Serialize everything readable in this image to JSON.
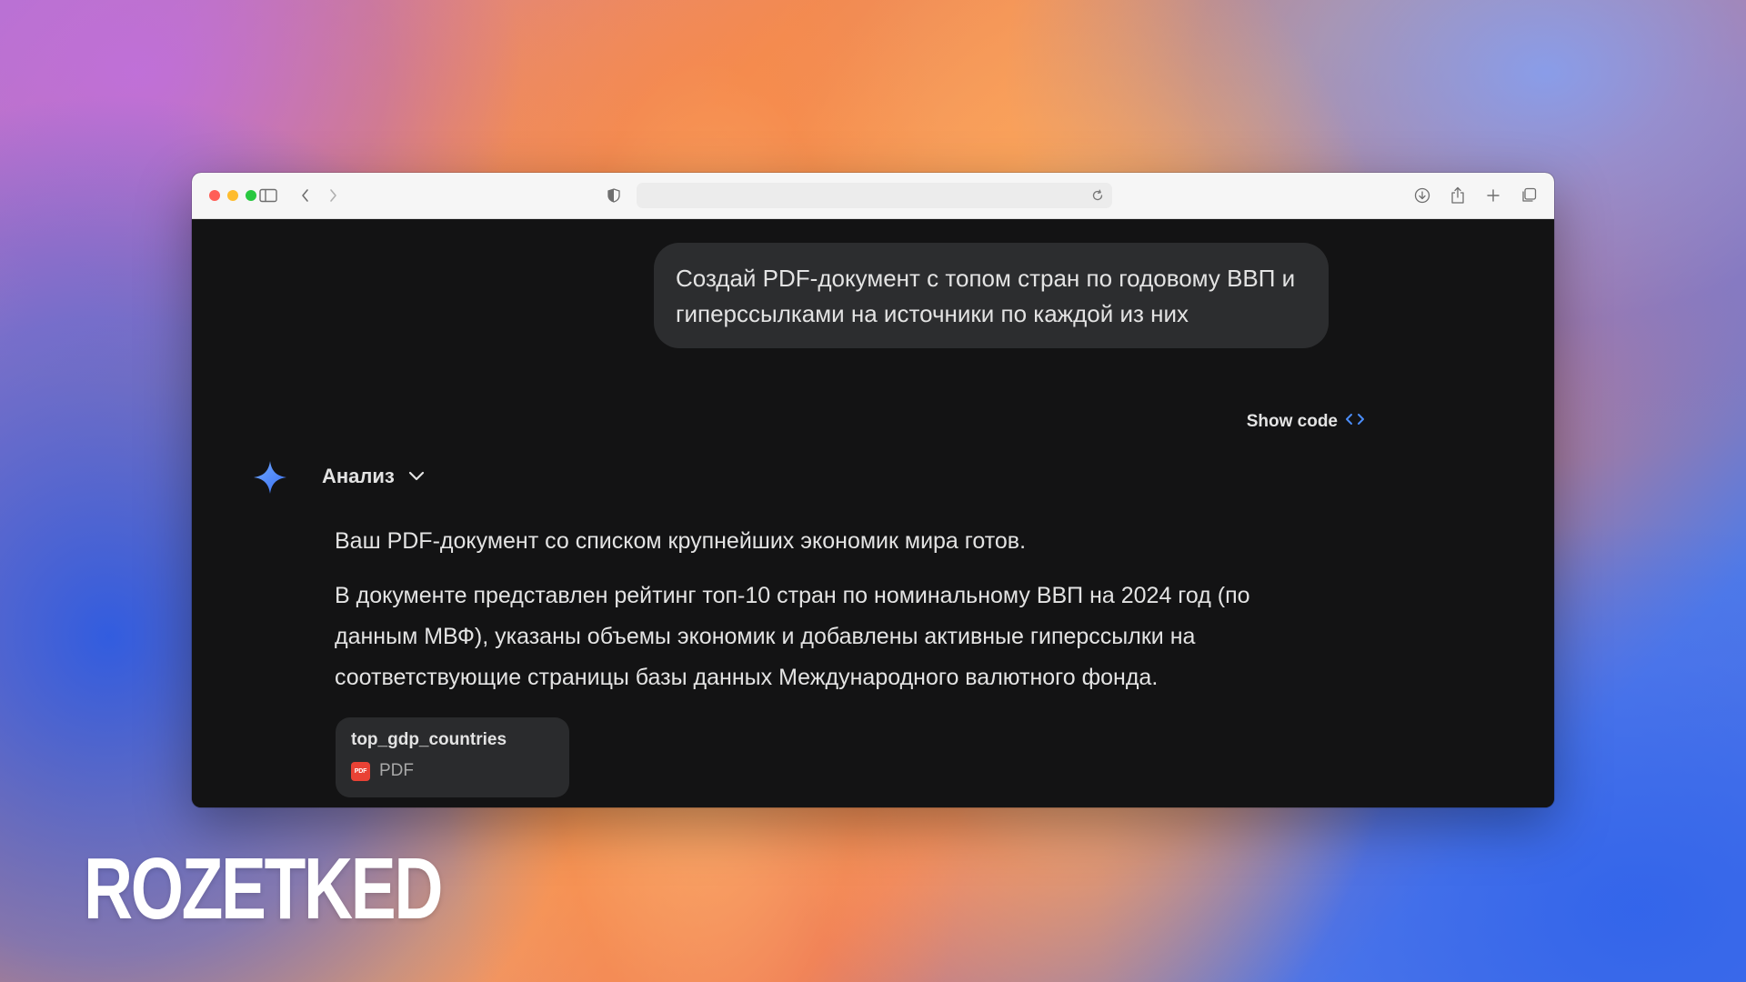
{
  "browser": {
    "address_text": "",
    "icons": {
      "sidebar": "sidebar-icon",
      "back": "chevron-left-icon",
      "forward": "chevron-right-icon",
      "privacy": "shield-icon",
      "reload": "reload-icon",
      "download": "download-icon",
      "share": "share-icon",
      "new_tab": "plus-icon",
      "tabs": "tab-overview-icon"
    }
  },
  "chat": {
    "user_message": "Создай PDF-документ с топом стран по годовому ВВП и гиперссылками на источники по каждой из них",
    "show_code_label": "Show code",
    "analysis_label": "Анализ",
    "response": {
      "paragraph1": "Ваш PDF-документ со списком крупнейших экономик мира готов.",
      "paragraph2": "В документе представлен рейтинг топ-10 стран по номинальному ВВП на 2024 год (по данным МВФ), указаны объемы экономик и добавлены активные гиперссылки на соответствующие страницы базы данных Международного валютного фонда."
    },
    "file": {
      "name": "top_gdp_countries",
      "type": "PDF",
      "icon_label": "PDF"
    }
  },
  "watermark": {
    "logo_text": "ROZETKED"
  },
  "colors": {
    "content_bg": "#131314",
    "bubble_bg": "#2c2d2f",
    "text": "#e3e3e3",
    "accent_blue": "#4b8df8",
    "pdf_red": "#e94235"
  }
}
